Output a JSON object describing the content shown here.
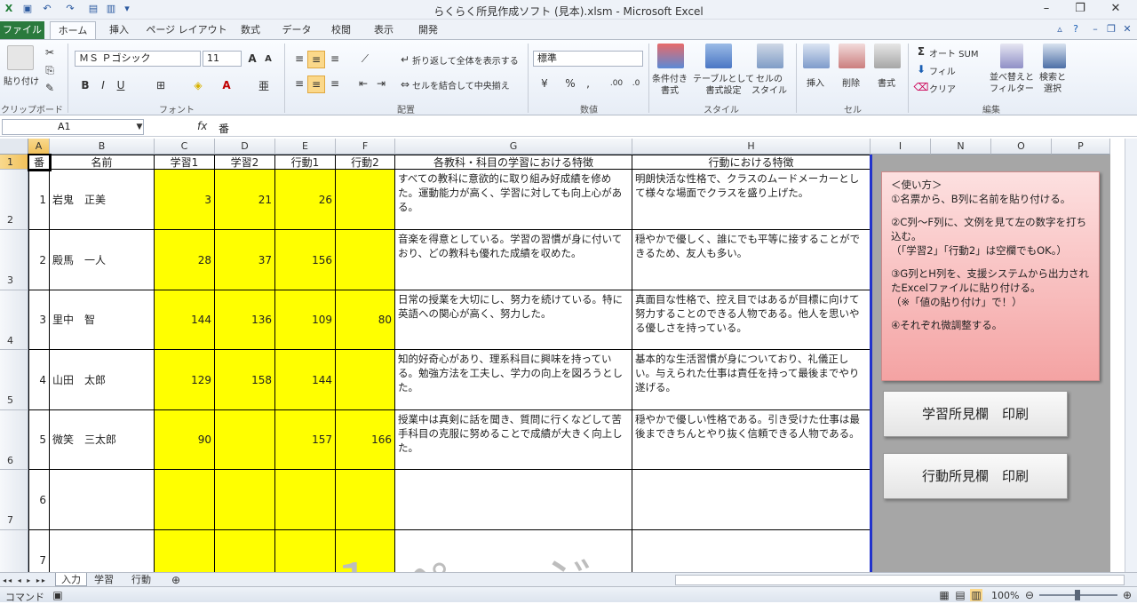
{
  "window": {
    "title": "らくらく所見作成ソフト (見本).xlsm  -  Microsoft Excel"
  },
  "ribbon_tabs": [
    "ファイル",
    "ホーム",
    "挿入",
    "ページ レイアウト",
    "数式",
    "データ",
    "校閲",
    "表示",
    "開発"
  ],
  "ribbon": {
    "clipboard": {
      "paste": "貼り付け",
      "label": "クリップボード"
    },
    "font": {
      "name": "ＭＳ Ｐゴシック",
      "size": "11",
      "label": "フォント"
    },
    "alignment": {
      "wrap": "折り返して全体を表示する",
      "merge": "セルを結合して中央揃え",
      "label": "配置"
    },
    "number": {
      "format": "標準",
      "label": "数値"
    },
    "styles": {
      "conditional": "条件付き\n書式",
      "table": "テーブルとして\n書式設定",
      "cell": "セルの\nスタイル",
      "label": "スタイル"
    },
    "cells": {
      "insert": "挿入",
      "delete": "削除",
      "format": "書式",
      "label": "セル"
    },
    "editing": {
      "autosum": "オート SUM",
      "fill": "フィル",
      "clear": "クリア",
      "sort": "並べ替えと\nフィルター",
      "find": "検索と\n選択",
      "label": "編集"
    }
  },
  "formula_bar": {
    "name_box": "A1",
    "fx": "fx",
    "content": "番"
  },
  "columns": [
    "A",
    "B",
    "C",
    "D",
    "E",
    "F",
    "G",
    "H",
    "I",
    "N",
    "O",
    "P"
  ],
  "table": {
    "headers": [
      "番",
      "名前",
      "学習1",
      "学習2",
      "行動1",
      "行動2",
      "各教科・科目の学習における特徴",
      "行動における特徴"
    ],
    "rows": [
      {
        "rownum": "2",
        "no": "1",
        "name": "岩鬼　正美",
        "s1": "3",
        "s2": "21",
        "b1": "26",
        "b2": "",
        "g": "すべての教科に意欲的に取り組み好成績を修めた。運動能力が高く、学習に対しても向上心がある。",
        "h": "明朗快活な性格で、クラスのムードメーカーとして様々な場面でクラスを盛り上げた。"
      },
      {
        "rownum": "3",
        "no": "2",
        "name": "殿馬　一人",
        "s1": "28",
        "s2": "37",
        "b1": "156",
        "b2": "",
        "g": "音楽を得意としている。学習の習慣が身に付いており、どの教科も優れた成績を収めた。",
        "h": "穏やかで優しく、誰にでも平等に接することができるため、友人も多い。"
      },
      {
        "rownum": "4",
        "no": "3",
        "name": "里中　智",
        "s1": "144",
        "s2": "136",
        "b1": "109",
        "b2": "80",
        "g": "日常の授業を大切にし、努力を続けている。特に英語への関心が高く、努力した。",
        "h": "真面目な性格で、控え目ではあるが目標に向けて努力することのできる人物である。他人を思いやる優しさを持っている。"
      },
      {
        "rownum": "5",
        "no": "4",
        "name": "山田　太郎",
        "s1": "129",
        "s2": "158",
        "b1": "144",
        "b2": "",
        "g": "知的好奇心があり、理系科目に興味を持っている。勉強方法を工夫し、学力の向上を図ろうとした。",
        "h": "基本的な生活習慣が身についており、礼儀正しい。与えられた仕事は責任を持って最後までやり遂げる。"
      },
      {
        "rownum": "6",
        "no": "5",
        "name": "微笑　三太郎",
        "s1": "90",
        "s2": "",
        "b1": "157",
        "b2": "166",
        "g": "授業中は真剣に話を聞き、質問に行くなどして苦手科目の克服に努めることで成績が大きく向上した。",
        "h": "穏やかで優しい性格である。引き受けた仕事は最後まできちんとやり抜く信頼できる人物である。"
      },
      {
        "rownum": "7",
        "no": "6",
        "name": "",
        "s1": "",
        "s2": "",
        "b1": "",
        "b2": "",
        "g": "",
        "h": ""
      },
      {
        "rownum": "8",
        "no": "7",
        "name": "",
        "s1": "",
        "s2": "",
        "b1": "",
        "b2": "",
        "g": "",
        "h": ""
      }
    ]
  },
  "watermark": "１ページ",
  "howto": {
    "title": "＜使い方＞",
    "step1": "①名票から、B列に名前を貼り付ける。",
    "step2a": "②C列～F列に、文例を見て左の数字を打ち込む。",
    "step2b": "（「学習2」「行動2」は空欄でもOK。）",
    "step3a": "③G列とH列を、支援システムから出力されたExcelファイルに貼り付ける。",
    "step3b": "（※「値の貼り付け」で！）",
    "step4": "④それぞれ微調整する。"
  },
  "buttons": {
    "print_study": "学習所見欄　印刷",
    "print_behavior": "行動所見欄　印刷"
  },
  "sheet_tabs": [
    "入力",
    "学習",
    "行動"
  ],
  "status": {
    "mode": "コマンド",
    "zoom": "100%"
  }
}
